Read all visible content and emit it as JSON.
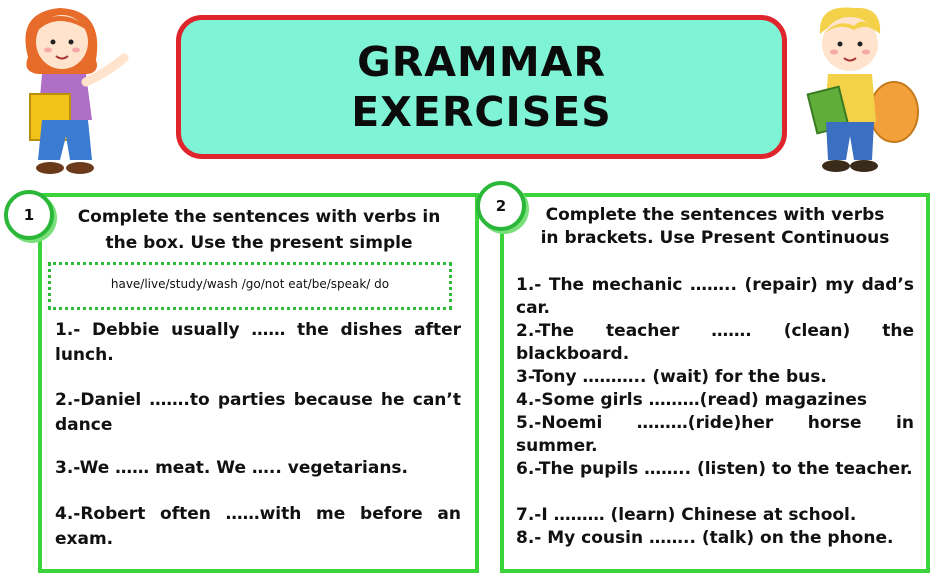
{
  "header": {
    "title_line1": "GRAMMAR",
    "title_line2": "EXERCISES"
  },
  "exercise1": {
    "number": "1",
    "instruction_line1": "Complete the sentences with verbs in",
    "instruction_line2": "the box. Use the present simple",
    "word_box": "have/live/study/wash /go/not eat/be/speak/ do",
    "sentences": [
      "1.- Debbie usually …… the dishes after lunch.",
      "2.-Daniel …….to parties because he can’t dance",
      "3.-We …… meat. We ….. vegetarians.",
      "4.-Robert often ……with me before an exam."
    ]
  },
  "exercise2": {
    "number": "2",
    "instruction_line1": "Complete the sentences with verbs",
    "instruction_line2": "in brackets. Use Present Continuous",
    "sentences": [
      "1.- The mechanic …….. (repair) my dad’s car.",
      "2.-The teacher ……. (clean) the blackboard.",
      "3-Tony ……….. (wait) for the bus.",
      "4.-Some girls ………(read) magazines",
      "5.-Noemi ………(ride)her horse in summer.",
      "6.-The pupils …….. (listen) to the teacher.",
      "7.-I ……… (learn) Chinese at school.",
      "8.- My cousin …….. (talk) on the phone."
    ]
  }
}
